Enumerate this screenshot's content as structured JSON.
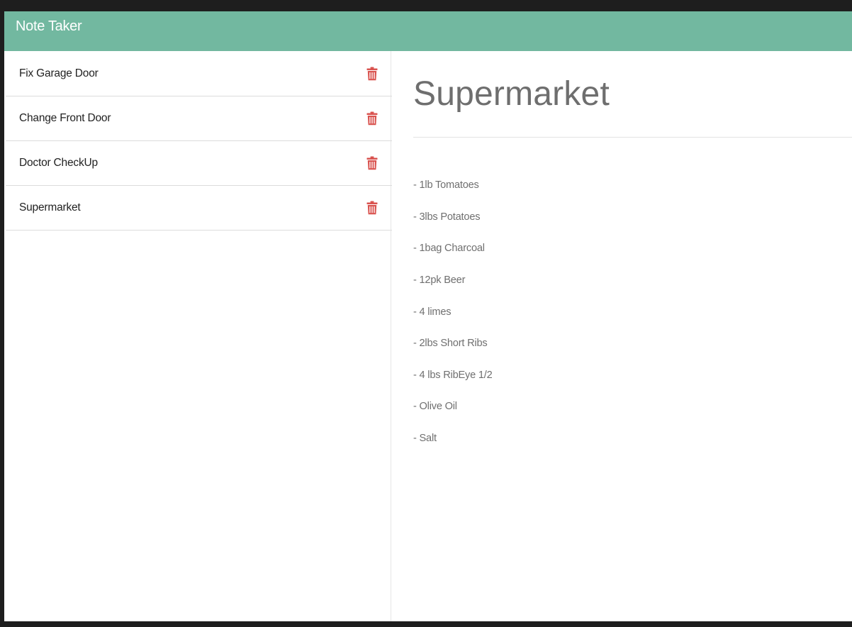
{
  "app": {
    "brand": "Note Taker"
  },
  "notes": [
    {
      "title": "Fix Garage Door"
    },
    {
      "title": "Change Front Door"
    },
    {
      "title": "Doctor CheckUp"
    },
    {
      "title": "Supermarket"
    }
  ],
  "active_note": {
    "title": "Supermarket",
    "body_lines": [
      "- 1lb Tomatoes",
      "- 3lbs Potatoes",
      "- 1bag Charcoal",
      "- 12pk Beer",
      "- 4 limes",
      "- 2lbs Short Ribs",
      "- 4 lbs RibEye 1/2",
      "- Olive Oil",
      "- Salt"
    ]
  },
  "icons": {
    "delete": "trash-icon"
  },
  "colors": {
    "navbar": "#72b8a0",
    "delete_icon": "#d9534f",
    "background_frame": "#1e1e1e"
  }
}
